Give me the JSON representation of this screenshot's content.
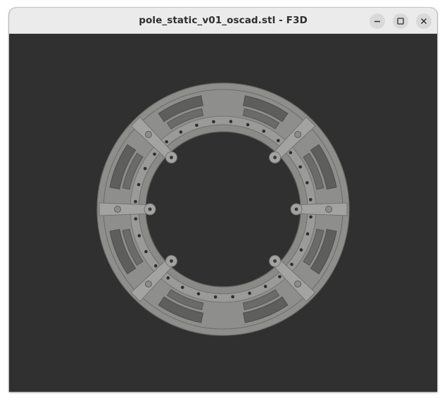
{
  "window": {
    "title": "pole_static_v01_oscad.stl - F3D",
    "buttons": {
      "minimize": "minimize-icon",
      "maximize": "maximize-icon",
      "close": "close-icon"
    }
  },
  "viewport": {
    "background": "#303030",
    "model_color": "#8e8e8c"
  }
}
